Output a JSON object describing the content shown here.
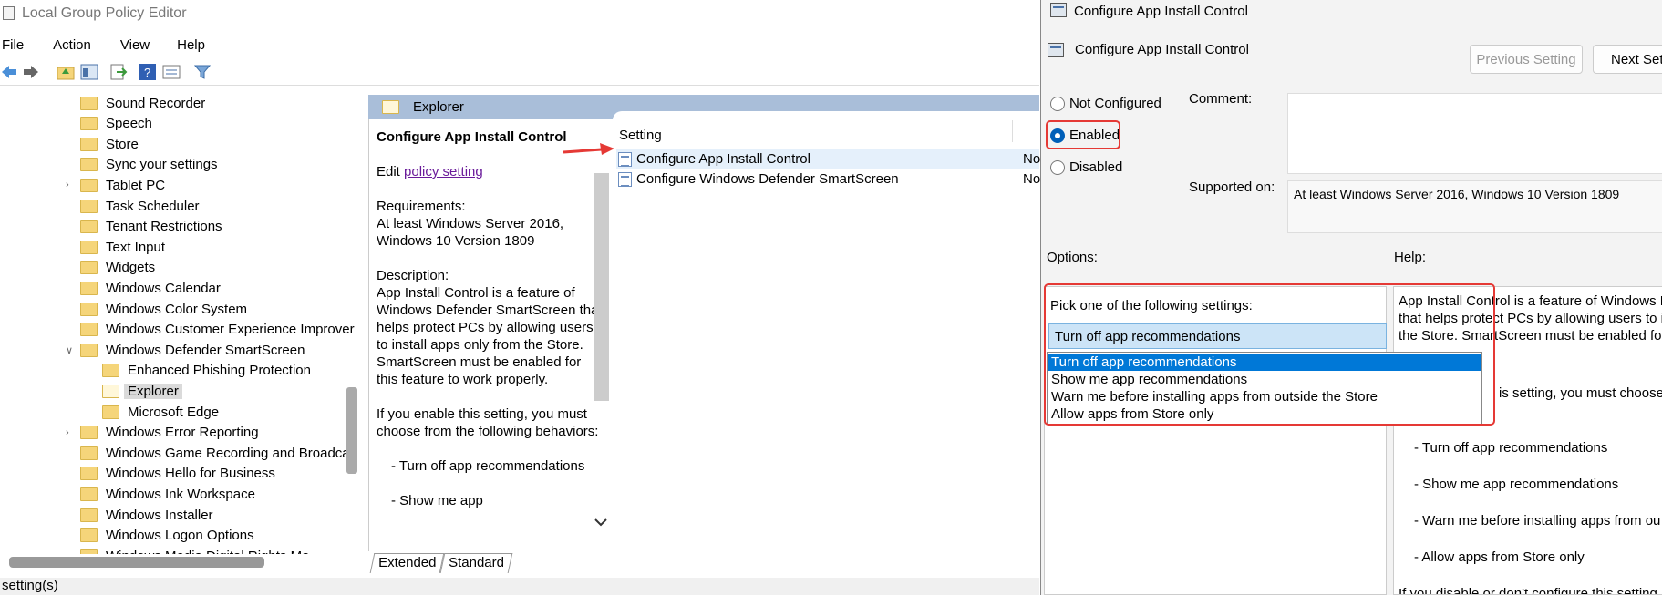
{
  "editor": {
    "title": "Local Group Policy Editor",
    "menu": [
      "File",
      "Action",
      "View",
      "Help"
    ],
    "tree": [
      {
        "label": "Sound Recorder",
        "level": 1
      },
      {
        "label": "Speech",
        "level": 1
      },
      {
        "label": "Store",
        "level": 1
      },
      {
        "label": "Sync your settings",
        "level": 1
      },
      {
        "label": "Tablet PC",
        "level": 1,
        "expander": ">"
      },
      {
        "label": "Task Scheduler",
        "level": 1
      },
      {
        "label": "Tenant Restrictions",
        "level": 1
      },
      {
        "label": "Text Input",
        "level": 1
      },
      {
        "label": "Widgets",
        "level": 1
      },
      {
        "label": "Windows Calendar",
        "level": 1
      },
      {
        "label": "Windows Color System",
        "level": 1
      },
      {
        "label": "Windows Customer Experience Improver",
        "level": 1
      },
      {
        "label": "Windows Defender SmartScreen",
        "level": 1,
        "expander": "v"
      },
      {
        "label": "Enhanced Phishing Protection",
        "level": 2
      },
      {
        "label": "Explorer",
        "level": 2,
        "selected": true
      },
      {
        "label": "Microsoft Edge",
        "level": 2
      },
      {
        "label": "Windows Error Reporting",
        "level": 1,
        "expander": ">"
      },
      {
        "label": "Windows Game Recording and Broadcas",
        "level": 1
      },
      {
        "label": "Windows Hello for Business",
        "level": 1
      },
      {
        "label": "Windows Ink Workspace",
        "level": 1
      },
      {
        "label": "Windows Installer",
        "level": 1
      },
      {
        "label": "Windows Logon Options",
        "level": 1
      },
      {
        "label": "Windows Media Digital Rights Ma",
        "level": 1
      }
    ],
    "folder_header": "Explorer",
    "extended": {
      "title": "Configure App Install Control",
      "edit_prefix": "Edit ",
      "edit_link": "policy setting ",
      "requirements_label": "Requirements:",
      "requirements": "At least Windows Server 2016, Windows 10 Version 1809",
      "description_label": "Description:",
      "description": "App Install Control is a feature of Windows Defender SmartScreen that helps protect PCs by allowing users to install apps only from the Store.  SmartScreen must be enabled for this feature to work properly.",
      "enable_text": "If you enable this setting, you must choose from the following behaviors:",
      "bullet1": "- Turn off app recommendations",
      "bullet2": "- Show me app"
    },
    "list": {
      "column_setting": "Setting",
      "rows": [
        {
          "name": "Configure App Install Control",
          "state": "No"
        },
        {
          "name": "Configure Windows Defender SmartScreen",
          "state": "No"
        }
      ]
    },
    "tabs": [
      "Extended",
      "Standard"
    ],
    "status": "setting(s)"
  },
  "dialog": {
    "window_title": "Configure App Install Control",
    "header_title": "Configure App Install Control",
    "prev_button": "Previous Setting",
    "next_button": "Next Set",
    "radio_not_configured": "Not Configured",
    "radio_enabled": "Enabled",
    "radio_disabled": "Disabled",
    "selected_state": "Enabled",
    "comment_label": "Comment:",
    "supported_label": "Supported on:",
    "supported_value": "At least Windows Server 2016, Windows 10 Version 1809",
    "options_label": "Options:",
    "help_label": "Help:",
    "pick_label": "Pick one of the following settings:",
    "combo_value": "Turn off app recommendations",
    "dropdown_options": [
      "Turn off app recommendations",
      "Show me app recommendations",
      "Warn me before installing apps from outside the Store",
      "Allow apps from Store only"
    ],
    "help_lines": [
      "App Install Control is a feature of Windows D",
      "that helps protect PCs by allowing users to in",
      "the Store.  SmartScreen must be enabled for t",
      "is setting, you must choose fr",
      "- Turn off app recommendations",
      "- Show me app recommendations",
      "- Warn me before installing apps from ou",
      "- Allow apps from Store only",
      "If you disable or don't configure this setting"
    ],
    "highlight_color": "#e53935",
    "accent_color": "#0078d7"
  }
}
